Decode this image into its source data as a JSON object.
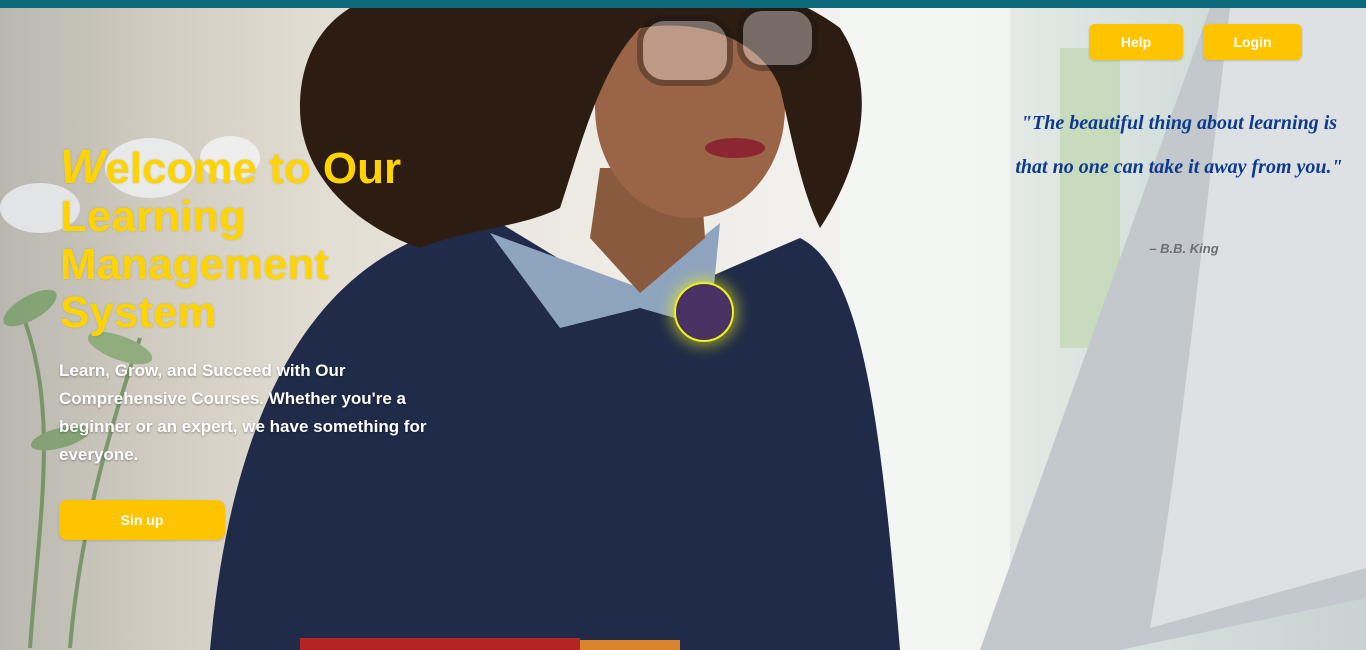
{
  "header": {
    "help_label": "Help",
    "login_label": "Login"
  },
  "hero": {
    "title_first_letter": "W",
    "title_rest": "elcome to Our Learning Management System",
    "subtitle": "Learn, Grow, and Succeed with Our Comprehensive Courses. Whether you're a beginner or an expert, we have something for everyone.",
    "signup_label": "Sin up"
  },
  "quote": {
    "text": "\"The beautiful thing about learning is that no one can take it away from you.\"",
    "author": "– B.B. King"
  },
  "colors": {
    "accent": "#ffc400",
    "title": "#ffd400",
    "quote": "#0d3b8c",
    "top_bar": "#0c6a7a",
    "circle_fill": "#4a3163",
    "circle_glow": "#f1f11a"
  },
  "background": {
    "image_subject": "woman with glasses working at a computer"
  }
}
